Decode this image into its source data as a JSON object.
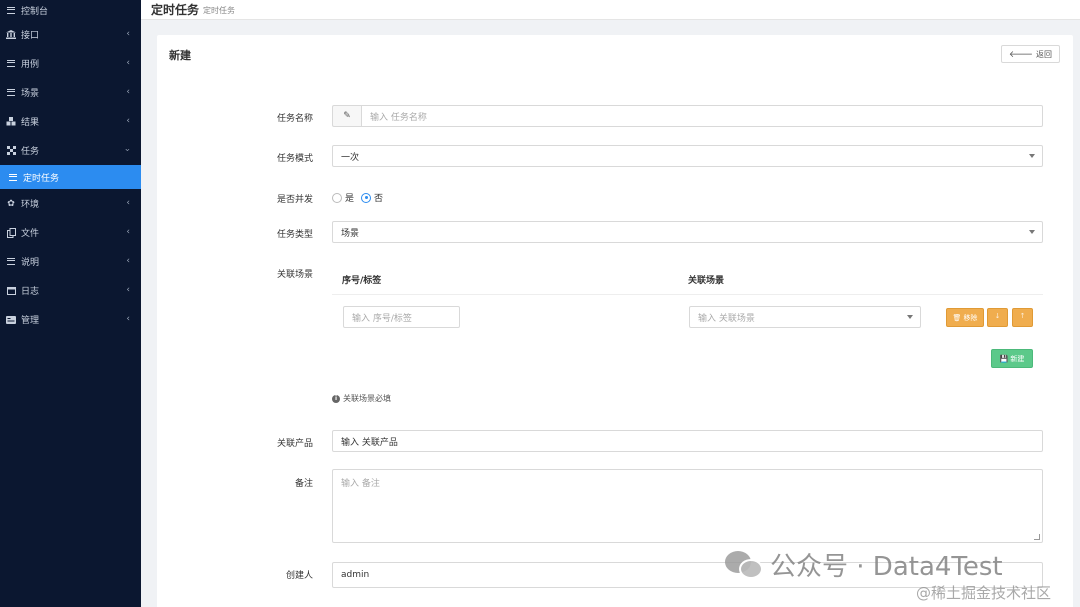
{
  "sidebar": {
    "items": [
      {
        "label": "控制台",
        "icon": "bars-icon"
      },
      {
        "label": "接口",
        "icon": "bank-icon"
      },
      {
        "label": "用例",
        "icon": "bars-icon"
      },
      {
        "label": "场景",
        "icon": "bars-icon"
      },
      {
        "label": "结果",
        "icon": "cubes-icon"
      },
      {
        "label": "任务",
        "icon": "tasks-icon"
      },
      {
        "label": "定时任务",
        "icon": "bars-icon"
      },
      {
        "label": "环境",
        "icon": "gear-icon"
      },
      {
        "label": "文件",
        "icon": "copy-icon"
      },
      {
        "label": "说明",
        "icon": "bars-icon"
      },
      {
        "label": "日志",
        "icon": "calendar-icon"
      },
      {
        "label": "管理",
        "icon": "card-icon"
      }
    ]
  },
  "header": {
    "title": "定时任务",
    "subtitle": "定时任务"
  },
  "panel": {
    "title": "新建",
    "back_label": "返回"
  },
  "form": {
    "name_label": "任务名称",
    "name_placeholder": "输入 任务名称",
    "mode_label": "任务模式",
    "mode_value": "一次",
    "concurrent_label": "是否并发",
    "concurrent_yes": "是",
    "concurrent_no": "否",
    "concurrent_selected": "否",
    "type_label": "任务类型",
    "type_value": "场景",
    "scene_label": "关联场景",
    "scene_table": {
      "col_seq": "序号/标签",
      "col_scene": "关联场景",
      "seq_placeholder": "输入 序号/标签",
      "scene_placeholder": "输入 关联场景",
      "remove_label": "移除",
      "add_label": "新建"
    },
    "scene_help": "关联场景必填",
    "product_label": "关联产品",
    "product_placeholder": "输入 关联产品",
    "remark_label": "备注",
    "remark_placeholder": "输入 备注",
    "creator_label": "创建人",
    "creator_value": "admin"
  },
  "watermark": {
    "main": "公众号 · Data4Test",
    "secondary": "@稀土掘金技术社区"
  },
  "colors": {
    "sidebar_bg": "#0b1730",
    "active": "#2c8cf0",
    "orange": "#f0ad4e",
    "green": "#5cc98a"
  }
}
